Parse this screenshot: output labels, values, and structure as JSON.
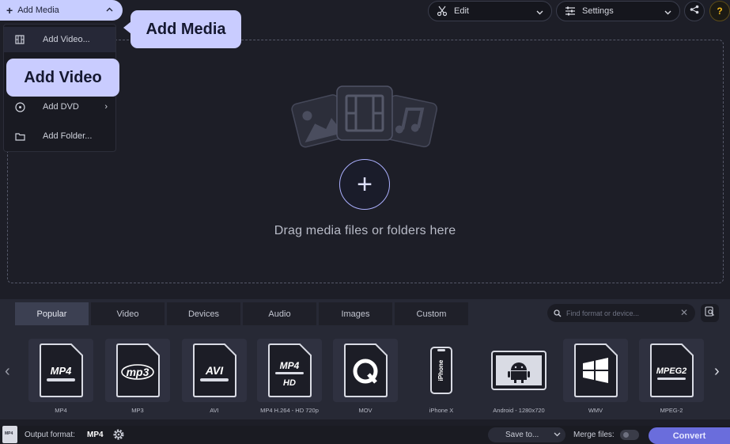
{
  "toolbar": {
    "add_media_label": "Add Media",
    "edit_label": "Edit",
    "settings_label": "Settings",
    "help_label": "?"
  },
  "add_menu": {
    "items": [
      {
        "label": "Add Video...",
        "icon": "video-icon"
      },
      {
        "label": "Add DVD",
        "icon": "dvd-icon"
      },
      {
        "label": "Add Folder...",
        "icon": "folder-icon"
      }
    ]
  },
  "callouts": {
    "add_media": "Add Media",
    "add_video": "Add Video"
  },
  "dropzone": {
    "text": "Drag media files or folders here"
  },
  "formats": {
    "tabs": [
      "Popular",
      "Video",
      "Devices",
      "Audio",
      "Images",
      "Custom"
    ],
    "active_tab": "Popular",
    "search_placeholder": "Find format or device...",
    "items": [
      {
        "caption": "MP4",
        "icon_text": "MP4"
      },
      {
        "caption": "MP3",
        "icon_text": "mp3"
      },
      {
        "caption": "AVI",
        "icon_text": "AVI"
      },
      {
        "caption": "MP4 H.264 - HD 720p",
        "icon_text": "MP4",
        "icon_sub": "HD"
      },
      {
        "caption": "MOV",
        "icon_text": "Q"
      },
      {
        "caption": "iPhone X",
        "icon_text": "iPhone"
      },
      {
        "caption": "Android - 1280x720",
        "icon_text": ""
      },
      {
        "caption": "WMV",
        "icon_text": ""
      },
      {
        "caption": "MPEG-2",
        "icon_text": "MPEG2"
      }
    ]
  },
  "status": {
    "output_format_label": "Output format:",
    "output_format_value": "MP4",
    "save_to_label": "Save to...",
    "merge_label": "Merge files:",
    "convert_label": "Convert"
  },
  "colors": {
    "accent": "#c7cdff",
    "convert": "#6a6ddc",
    "background": "#1d1e27",
    "panel": "#272935"
  }
}
